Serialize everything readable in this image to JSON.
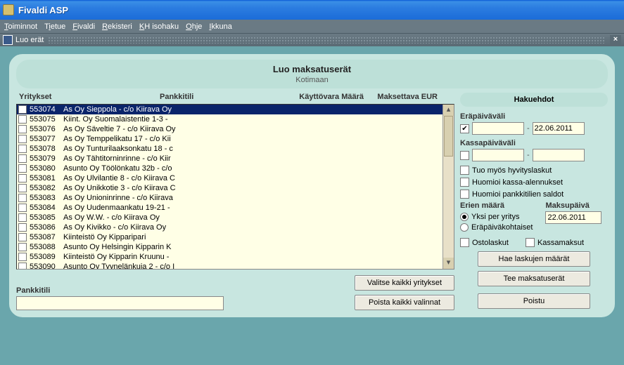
{
  "window": {
    "title": "Fivaldi ASP"
  },
  "menubar": {
    "items": [
      "Toiminnot",
      "Tietue",
      "Fivaldi",
      "Rekisteri",
      "KH isohaku",
      "Ohje",
      "Ikkuna"
    ],
    "ul": [
      0,
      0,
      0,
      0,
      0,
      0,
      0
    ]
  },
  "subwindow": {
    "title": "Luo erät"
  },
  "panel": {
    "title": "Luo maksatuserät",
    "subtitle": "Kotimaan"
  },
  "columns": {
    "c1": "Yritykset",
    "c2": "Pankkitili",
    "c3": "Käyttövara Määrä",
    "c4": "Maksettava EUR"
  },
  "companies": [
    {
      "code": "553074",
      "name": "As Oy Sieppola - c/o Kiirava Oy",
      "selected": true
    },
    {
      "code": "553075",
      "name": "Kiint. Oy Suomalaistentie 1-3 - "
    },
    {
      "code": "553076",
      "name": "As Oy Säveltie 7 - c/o Kiirava Oy"
    },
    {
      "code": "553077",
      "name": "As Oy Temppelikatu 17 - c/o Kii"
    },
    {
      "code": "553078",
      "name": "As Oy Tunturilaaksonkatu 18 - c"
    },
    {
      "code": "553079",
      "name": "As Oy Tähtitorninrinne - c/o Kiir"
    },
    {
      "code": "553080",
      "name": "Asunto Oy Töölönkatu 32b - c/o "
    },
    {
      "code": "553081",
      "name": "As Oy Ulvilantie 8 - c/o Kiirava C"
    },
    {
      "code": "553082",
      "name": "As Oy Unikkotie 3 - c/o Kiirava C"
    },
    {
      "code": "553083",
      "name": "As Oy Unioninrinne - c/o Kiirava"
    },
    {
      "code": "553084",
      "name": "As Oy Uudenmaankatu 19-21 - "
    },
    {
      "code": "553085",
      "name": "As Oy W.W. - c/o Kiirava Oy"
    },
    {
      "code": "553086",
      "name": "As Oy Kivikko - c/o Kiirava Oy"
    },
    {
      "code": "553087",
      "name": "Kiinteistö Oy Kipparipari"
    },
    {
      "code": "553088",
      "name": "Asunto Oy Helsingin Kipparin K"
    },
    {
      "code": "553089",
      "name": "Kiinteistö Oy Kipparin Kruunu - "
    },
    {
      "code": "553090",
      "name": "Asunto Oy Tyynelänkuja 2 - c/o I"
    }
  ],
  "pankkitili": {
    "label": "Pankkitili",
    "value": ""
  },
  "buttons": {
    "select_all": "Valitse kaikki yritykset",
    "remove_all": "Poista kaikki valinnat",
    "hae": "Hae laskujen määrät",
    "tee": "Tee maksatuserät",
    "poistu": "Poistu"
  },
  "search": {
    "title": "Hakuehdot",
    "erapaiva_label": "Eräpäiväväli",
    "erapaiva": {
      "enabled": true,
      "from": "",
      "to": "22.06.2011"
    },
    "kassapaiva_label": "Kassapäiväväli",
    "kassapaiva": {
      "enabled": false,
      "from": "",
      "to": ""
    },
    "chk_hyvitys": "Tuo myös hyvityslaskut",
    "chk_kassa_alen": "Huomioi kassa-alennukset",
    "chk_pankki_saldo": "Huomioi pankkitilien saldot",
    "erien_label": "Erien määrä",
    "maksupvm_label": "Maksupäivä",
    "maksupvm": "22.06.2011",
    "rb_yksi": "Yksi per yritys",
    "rb_erapvm": "Eräpäiväkohtaiset",
    "rb_selected": "yksi",
    "chk_osto": "Ostolaskut",
    "chk_kassam": "Kassamaksut"
  }
}
